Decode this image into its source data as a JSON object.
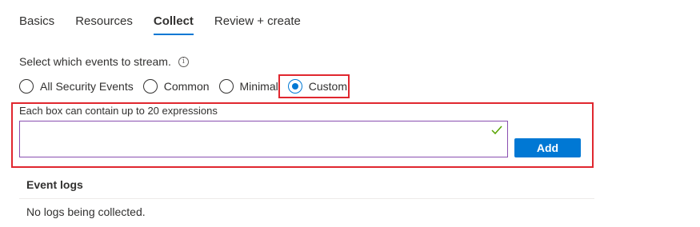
{
  "tabs": [
    {
      "label": "Basics",
      "active": false
    },
    {
      "label": "Resources",
      "active": false
    },
    {
      "label": "Collect",
      "active": true
    },
    {
      "label": "Review + create",
      "active": false
    }
  ],
  "events": {
    "prompt": "Select which events to stream.",
    "options": [
      {
        "label": "All Security Events",
        "checked": false
      },
      {
        "label": "Common",
        "checked": false
      },
      {
        "label": "Minimal",
        "checked": false
      },
      {
        "label": "Custom",
        "checked": true
      }
    ]
  },
  "expressions": {
    "label": "Each box can contain up to 20 expressions",
    "value": "",
    "add_label": "Add"
  },
  "logs": {
    "header": "Event logs",
    "empty_text": "No logs being collected."
  },
  "colors": {
    "accent": "#0078d4",
    "highlight": "#e0272f",
    "valid_check": "#57a300",
    "input_border": "#8a4fb0"
  },
  "icons": {
    "info": "info-icon",
    "valid": "checkmark-icon"
  }
}
